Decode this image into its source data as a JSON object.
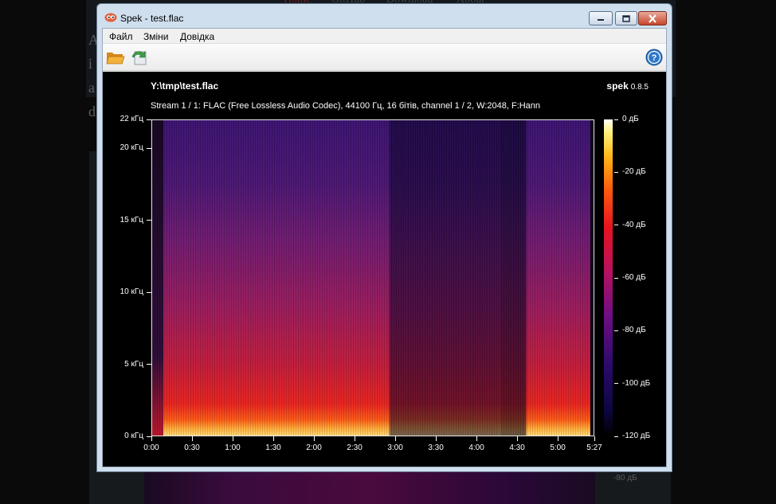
{
  "background": {
    "nav": [
      "Home",
      "GitHub",
      "Download",
      "About"
    ],
    "letters": [
      "A",
      "i",
      "a",
      "d"
    ],
    "ghost_label": "-80 дБ"
  },
  "window": {
    "title": "Spek - test.flac",
    "icon": "spek-app-icon",
    "caption_buttons": [
      "minimize-icon",
      "maximize-icon",
      "close-icon"
    ]
  },
  "menu": {
    "items": [
      "Файл",
      "Зміни",
      "Довідка"
    ]
  },
  "toolbar": {
    "open_icon": "folder-open-icon",
    "save_icon": "save-icon",
    "help_icon": "help-icon"
  },
  "plot": {
    "file_title": "Y:\\tmp\\test.flac",
    "brand": "spek",
    "version": "0.8.5",
    "stream_info": "Stream 1 / 1: FLAC (Free Lossless Audio Codec), 44100 Гц, 16 бітів, channel 1 / 2, W:2048, F:Hann",
    "freq_ticks": [
      {
        "label": "22 кГц",
        "value": 22
      },
      {
        "label": "20 кГц",
        "value": 20
      },
      {
        "label": "15 кГц",
        "value": 15
      },
      {
        "label": "10 кГц",
        "value": 10
      },
      {
        "label": "5 кГц",
        "value": 5
      },
      {
        "label": "0 кГц",
        "value": 0
      }
    ],
    "time_ticks": [
      {
        "label": "0:00",
        "value": 0
      },
      {
        "label": "0:30",
        "value": 30
      },
      {
        "label": "1:00",
        "value": 60
      },
      {
        "label": "1:30",
        "value": 90
      },
      {
        "label": "2:00",
        "value": 120
      },
      {
        "label": "2:30",
        "value": 150
      },
      {
        "label": "3:00",
        "value": 180
      },
      {
        "label": "3:30",
        "value": 210
      },
      {
        "label": "4:00",
        "value": 240
      },
      {
        "label": "4:30",
        "value": 270
      },
      {
        "label": "5:00",
        "value": 300
      },
      {
        "label": "5:27",
        "value": 327
      }
    ],
    "freq_max": 22,
    "time_max": 327,
    "db_ticks": [
      {
        "label": "0 дБ",
        "value": 0
      },
      {
        "label": "-20 дБ",
        "value": -20
      },
      {
        "label": "-40 дБ",
        "value": -40
      },
      {
        "label": "-60 дБ",
        "value": -60
      },
      {
        "label": "-80 дБ",
        "value": -80
      },
      {
        "label": "-100 дБ",
        "value": -100
      },
      {
        "label": "-120 дБ",
        "value": -120
      }
    ],
    "db_range": [
      -120,
      0
    ]
  }
}
